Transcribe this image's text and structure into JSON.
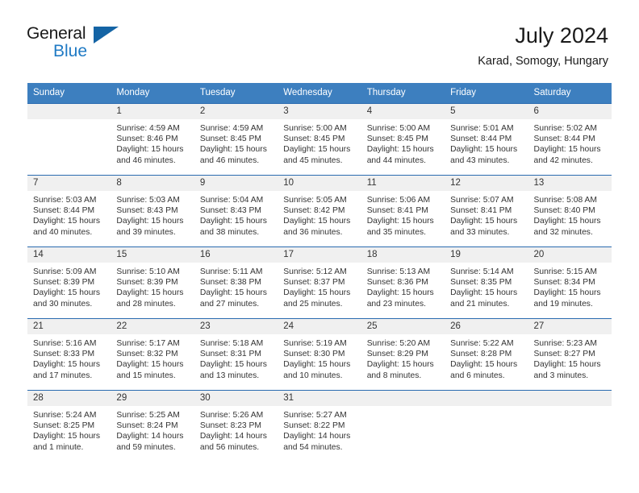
{
  "brand": {
    "name_part1": "General",
    "name_part2": "Blue",
    "logo_icon": "blue-triangle-icon"
  },
  "header": {
    "title": "July 2024",
    "location": "Karad, Somogy, Hungary"
  },
  "calendar": {
    "weekday_headers": [
      "Sunday",
      "Monday",
      "Tuesday",
      "Wednesday",
      "Thursday",
      "Friday",
      "Saturday"
    ],
    "accent_color": "#3d7fbf",
    "border_color": "#2a6bb0",
    "daynum_band_color": "#f0f0f0",
    "weeks": [
      [
        {
          "day": "",
          "blank": true,
          "sunrise": "",
          "sunset": "",
          "daylight_line1": "",
          "daylight_line2": ""
        },
        {
          "day": "1",
          "sunrise": "Sunrise: 4:59 AM",
          "sunset": "Sunset: 8:46 PM",
          "daylight_line1": "Daylight: 15 hours",
          "daylight_line2": "and 46 minutes."
        },
        {
          "day": "2",
          "sunrise": "Sunrise: 4:59 AM",
          "sunset": "Sunset: 8:45 PM",
          "daylight_line1": "Daylight: 15 hours",
          "daylight_line2": "and 46 minutes."
        },
        {
          "day": "3",
          "sunrise": "Sunrise: 5:00 AM",
          "sunset": "Sunset: 8:45 PM",
          "daylight_line1": "Daylight: 15 hours",
          "daylight_line2": "and 45 minutes."
        },
        {
          "day": "4",
          "sunrise": "Sunrise: 5:00 AM",
          "sunset": "Sunset: 8:45 PM",
          "daylight_line1": "Daylight: 15 hours",
          "daylight_line2": "and 44 minutes."
        },
        {
          "day": "5",
          "sunrise": "Sunrise: 5:01 AM",
          "sunset": "Sunset: 8:44 PM",
          "daylight_line1": "Daylight: 15 hours",
          "daylight_line2": "and 43 minutes."
        },
        {
          "day": "6",
          "sunrise": "Sunrise: 5:02 AM",
          "sunset": "Sunset: 8:44 PM",
          "daylight_line1": "Daylight: 15 hours",
          "daylight_line2": "and 42 minutes."
        }
      ],
      [
        {
          "day": "7",
          "sunrise": "Sunrise: 5:03 AM",
          "sunset": "Sunset: 8:44 PM",
          "daylight_line1": "Daylight: 15 hours",
          "daylight_line2": "and 40 minutes."
        },
        {
          "day": "8",
          "sunrise": "Sunrise: 5:03 AM",
          "sunset": "Sunset: 8:43 PM",
          "daylight_line1": "Daylight: 15 hours",
          "daylight_line2": "and 39 minutes."
        },
        {
          "day": "9",
          "sunrise": "Sunrise: 5:04 AM",
          "sunset": "Sunset: 8:43 PM",
          "daylight_line1": "Daylight: 15 hours",
          "daylight_line2": "and 38 minutes."
        },
        {
          "day": "10",
          "sunrise": "Sunrise: 5:05 AM",
          "sunset": "Sunset: 8:42 PM",
          "daylight_line1": "Daylight: 15 hours",
          "daylight_line2": "and 36 minutes."
        },
        {
          "day": "11",
          "sunrise": "Sunrise: 5:06 AM",
          "sunset": "Sunset: 8:41 PM",
          "daylight_line1": "Daylight: 15 hours",
          "daylight_line2": "and 35 minutes."
        },
        {
          "day": "12",
          "sunrise": "Sunrise: 5:07 AM",
          "sunset": "Sunset: 8:41 PM",
          "daylight_line1": "Daylight: 15 hours",
          "daylight_line2": "and 33 minutes."
        },
        {
          "day": "13",
          "sunrise": "Sunrise: 5:08 AM",
          "sunset": "Sunset: 8:40 PM",
          "daylight_line1": "Daylight: 15 hours",
          "daylight_line2": "and 32 minutes."
        }
      ],
      [
        {
          "day": "14",
          "sunrise": "Sunrise: 5:09 AM",
          "sunset": "Sunset: 8:39 PM",
          "daylight_line1": "Daylight: 15 hours",
          "daylight_line2": "and 30 minutes."
        },
        {
          "day": "15",
          "sunrise": "Sunrise: 5:10 AM",
          "sunset": "Sunset: 8:39 PM",
          "daylight_line1": "Daylight: 15 hours",
          "daylight_line2": "and 28 minutes."
        },
        {
          "day": "16",
          "sunrise": "Sunrise: 5:11 AM",
          "sunset": "Sunset: 8:38 PM",
          "daylight_line1": "Daylight: 15 hours",
          "daylight_line2": "and 27 minutes."
        },
        {
          "day": "17",
          "sunrise": "Sunrise: 5:12 AM",
          "sunset": "Sunset: 8:37 PM",
          "daylight_line1": "Daylight: 15 hours",
          "daylight_line2": "and 25 minutes."
        },
        {
          "day": "18",
          "sunrise": "Sunrise: 5:13 AM",
          "sunset": "Sunset: 8:36 PM",
          "daylight_line1": "Daylight: 15 hours",
          "daylight_line2": "and 23 minutes."
        },
        {
          "day": "19",
          "sunrise": "Sunrise: 5:14 AM",
          "sunset": "Sunset: 8:35 PM",
          "daylight_line1": "Daylight: 15 hours",
          "daylight_line2": "and 21 minutes."
        },
        {
          "day": "20",
          "sunrise": "Sunrise: 5:15 AM",
          "sunset": "Sunset: 8:34 PM",
          "daylight_line1": "Daylight: 15 hours",
          "daylight_line2": "and 19 minutes."
        }
      ],
      [
        {
          "day": "21",
          "sunrise": "Sunrise: 5:16 AM",
          "sunset": "Sunset: 8:33 PM",
          "daylight_line1": "Daylight: 15 hours",
          "daylight_line2": "and 17 minutes."
        },
        {
          "day": "22",
          "sunrise": "Sunrise: 5:17 AM",
          "sunset": "Sunset: 8:32 PM",
          "daylight_line1": "Daylight: 15 hours",
          "daylight_line2": "and 15 minutes."
        },
        {
          "day": "23",
          "sunrise": "Sunrise: 5:18 AM",
          "sunset": "Sunset: 8:31 PM",
          "daylight_line1": "Daylight: 15 hours",
          "daylight_line2": "and 13 minutes."
        },
        {
          "day": "24",
          "sunrise": "Sunrise: 5:19 AM",
          "sunset": "Sunset: 8:30 PM",
          "daylight_line1": "Daylight: 15 hours",
          "daylight_line2": "and 10 minutes."
        },
        {
          "day": "25",
          "sunrise": "Sunrise: 5:20 AM",
          "sunset": "Sunset: 8:29 PM",
          "daylight_line1": "Daylight: 15 hours",
          "daylight_line2": "and 8 minutes."
        },
        {
          "day": "26",
          "sunrise": "Sunrise: 5:22 AM",
          "sunset": "Sunset: 8:28 PM",
          "daylight_line1": "Daylight: 15 hours",
          "daylight_line2": "and 6 minutes."
        },
        {
          "day": "27",
          "sunrise": "Sunrise: 5:23 AM",
          "sunset": "Sunset: 8:27 PM",
          "daylight_line1": "Daylight: 15 hours",
          "daylight_line2": "and 3 minutes."
        }
      ],
      [
        {
          "day": "28",
          "sunrise": "Sunrise: 5:24 AM",
          "sunset": "Sunset: 8:25 PM",
          "daylight_line1": "Daylight: 15 hours",
          "daylight_line2": "and 1 minute."
        },
        {
          "day": "29",
          "sunrise": "Sunrise: 5:25 AM",
          "sunset": "Sunset: 8:24 PM",
          "daylight_line1": "Daylight: 14 hours",
          "daylight_line2": "and 59 minutes."
        },
        {
          "day": "30",
          "sunrise": "Sunrise: 5:26 AM",
          "sunset": "Sunset: 8:23 PM",
          "daylight_line1": "Daylight: 14 hours",
          "daylight_line2": "and 56 minutes."
        },
        {
          "day": "31",
          "sunrise": "Sunrise: 5:27 AM",
          "sunset": "Sunset: 8:22 PM",
          "daylight_line1": "Daylight: 14 hours",
          "daylight_line2": "and 54 minutes."
        },
        {
          "day": "",
          "blank": true,
          "sunrise": "",
          "sunset": "",
          "daylight_line1": "",
          "daylight_line2": ""
        },
        {
          "day": "",
          "blank": true,
          "sunrise": "",
          "sunset": "",
          "daylight_line1": "",
          "daylight_line2": ""
        },
        {
          "day": "",
          "blank": true,
          "sunrise": "",
          "sunset": "",
          "daylight_line1": "",
          "daylight_line2": ""
        }
      ]
    ]
  }
}
